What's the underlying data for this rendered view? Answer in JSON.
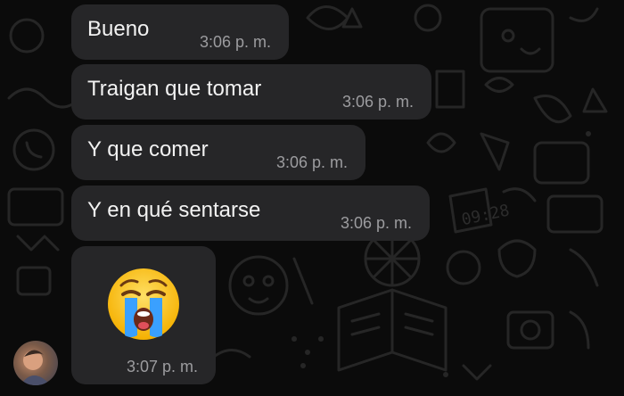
{
  "messages": [
    {
      "text": "Bueno",
      "time": "3:06 p. m."
    },
    {
      "text": "Traigan que tomar",
      "time": "3:06 p. m."
    },
    {
      "text": "Y que comer",
      "time": "3:06 p. m."
    },
    {
      "text": "Y en qué sentarse",
      "time": "3:06 p. m."
    },
    {
      "emoji": "loudly-crying-face",
      "time": "3:07 p. m."
    }
  ],
  "wallpaper": {
    "clock_doodle": "09:28"
  },
  "colors": {
    "background": "#0b0b0b",
    "bubble": "#262628",
    "text": "#f2f2f2",
    "time": "#9c9c9f"
  }
}
